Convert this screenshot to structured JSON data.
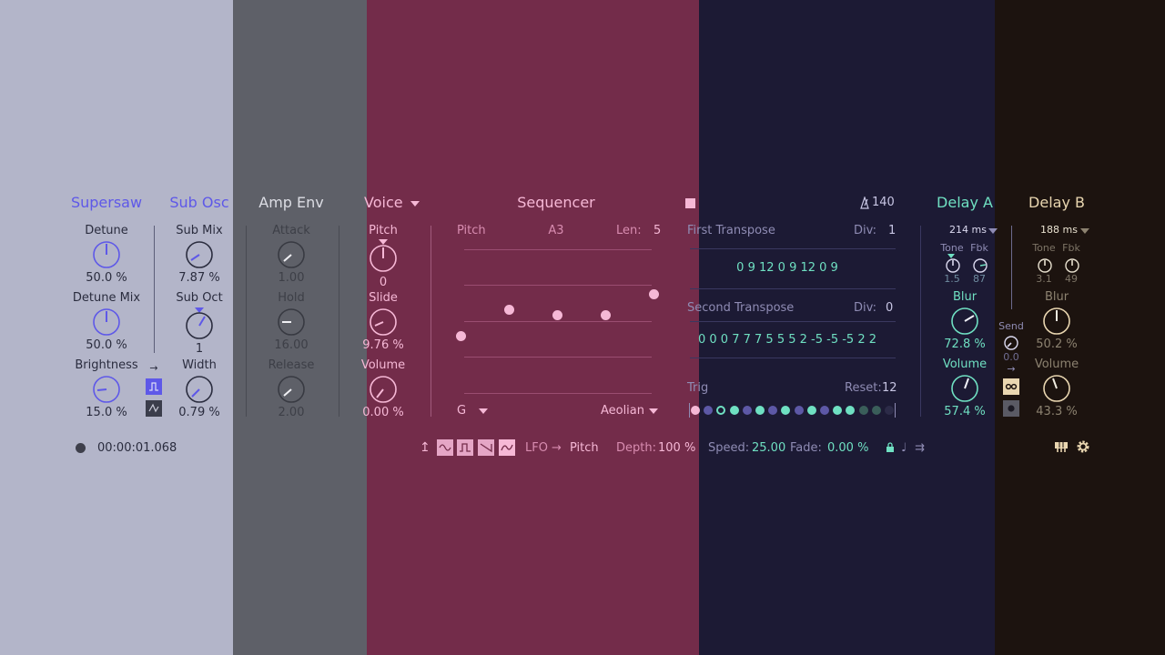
{
  "colors": {
    "supersaw_bg": "#b3b5c9",
    "ampenv_bg": "#5e6068",
    "voice_bg": "#732c4a",
    "delay_a_bg": "#1c1a34",
    "delay_b_bg": "#1c130f",
    "accent_blue": "#5e58e8",
    "accent_pink": "#f6b8d6",
    "accent_teal": "#6fe0c2",
    "accent_gold": "#e9d6b0"
  },
  "supersaw": {
    "title": "Supersaw",
    "detune": {
      "label": "Detune",
      "value": "50.0 %"
    },
    "detune_mix": {
      "label": "Detune Mix",
      "value": "50.0 %"
    },
    "brightness": {
      "label": "Brightness",
      "value": "15.0 %"
    }
  },
  "sub_osc": {
    "title": "Sub Osc",
    "sub_mix": {
      "label": "Sub Mix",
      "value": "7.87 %"
    },
    "sub_oct": {
      "label": "Sub Oct",
      "value": "1"
    },
    "width": {
      "label": "Width",
      "value": "0.79 %"
    },
    "arrow": "→"
  },
  "amp_env": {
    "title": "Amp Env",
    "attack": {
      "label": "Attack",
      "value": "1.00"
    },
    "hold": {
      "label": "Hold",
      "value": "16.00"
    },
    "release": {
      "label": "Release",
      "value": "2.00"
    }
  },
  "voice": {
    "title": "Voice",
    "pitch": {
      "label": "Pitch",
      "value": "0"
    },
    "slide": {
      "label": "Slide",
      "value": "9.76 %"
    },
    "volume": {
      "label": "Volume",
      "value": "0.00 %"
    }
  },
  "sequencer": {
    "title": "Sequencer",
    "pitch_label": "Pitch",
    "note": "A3",
    "len_label": "Len:",
    "len_value": "5",
    "key": "G",
    "scale": "Aeolian",
    "tempo": "140",
    "first_transpose": {
      "label": "First Transpose",
      "div_label": "Div:",
      "div_value": "1",
      "values": "0 9 12 0 9 12 0 9"
    },
    "second_transpose": {
      "label": "Second Transpose",
      "div_label": "Div:",
      "div_value": "0",
      "values": "0 0 0 7 7 7 5 5 5 2 -5 -5 -5 2 2"
    },
    "trig": {
      "label": "Trig",
      "reset_label": "Reset:",
      "reset_value": "12"
    },
    "steps": [
      {
        "n": 1,
        "level": 1
      },
      {
        "n": 2,
        "level": 0.6
      },
      {
        "n": 3,
        "level": 0.8
      },
      {
        "n": 4,
        "level": 1
      },
      {
        "n": 5,
        "level": 0.6
      },
      {
        "n": 6,
        "level": 1
      },
      {
        "n": 7,
        "level": 0.6
      },
      {
        "n": 8,
        "level": 1
      },
      {
        "n": 9,
        "level": 0.6
      },
      {
        "n": 10,
        "level": 1
      },
      {
        "n": 11,
        "level": 0.6
      },
      {
        "n": 12,
        "level": 1
      },
      {
        "n": 13,
        "level": 1
      },
      {
        "n": 14,
        "level": 0.3
      },
      {
        "n": 15,
        "level": 0.3
      },
      {
        "n": 16,
        "level": 0.2
      }
    ]
  },
  "lfo": {
    "label": "LFO",
    "arrow": "→",
    "target": "Pitch",
    "depth_label": "Depth:",
    "depth_value": "100 %",
    "speed_label": "Speed:",
    "speed_value": "25.00",
    "fade_label": "Fade:",
    "fade_value": "0.00 %"
  },
  "transport": {
    "time": "00:00:01.068"
  },
  "delay_a": {
    "title": "Delay A",
    "time": "214 ms",
    "tone": {
      "label": "Tone",
      "value": "1.5"
    },
    "fbk": {
      "label": "Fbk",
      "value": "87"
    },
    "blur": {
      "label": "Blur",
      "value": "72.8 %"
    },
    "volume": {
      "label": "Volume",
      "value": "57.4 %"
    }
  },
  "send": {
    "label": "Send",
    "value": "0.0",
    "arrow": "→"
  },
  "delay_b": {
    "title": "Delay B",
    "time": "188 ms",
    "tone": {
      "label": "Tone",
      "value": "3.1"
    },
    "fbk": {
      "label": "Fbk",
      "value": "49"
    },
    "blur": {
      "label": "Blur",
      "value": "50.2 %"
    },
    "volume": {
      "label": "Volume",
      "value": "43.3 %"
    }
  }
}
